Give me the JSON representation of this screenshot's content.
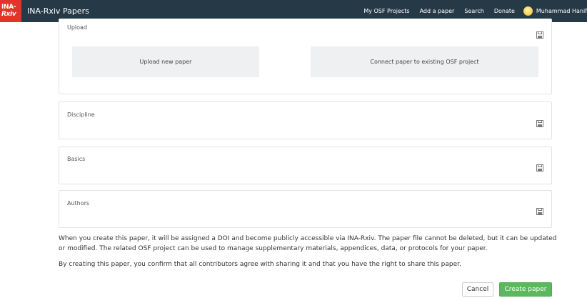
{
  "navbar": {
    "logo_line1": "INA-",
    "logo_line2": "Rxiv",
    "brand": "INA-Rxiv Papers",
    "links": [
      "My OSF Projects",
      "Add a paper",
      "Search",
      "Donate"
    ],
    "user_name": "Muhammad Hanif"
  },
  "sections": {
    "upload": {
      "title": "Upload",
      "upload_new_label": "Upload new paper",
      "connect_label": "Connect paper to existing OSF project"
    },
    "discipline": {
      "title": "Discipline"
    },
    "basics": {
      "title": "Basics"
    },
    "authors": {
      "title": "Authors"
    }
  },
  "info": {
    "paragraph1": "When you create this paper, it will be assigned a DOI and become publicly accessible via INA-Rxiv. The paper file cannot be deleted, but it can be updated or modified. The related OSF project can be used to manage supplementary materials, appendices, data, or protocols for your paper.",
    "paragraph2": "By creating this paper, you confirm that all contributors agree with sharing it and that you have the right to share this paper."
  },
  "actions": {
    "cancel_label": "Cancel",
    "create_label": "Create paper"
  },
  "colors": {
    "navbar_bg": "#263947",
    "logo_bg": "#e2342b",
    "create_button": "#5cb85c"
  }
}
